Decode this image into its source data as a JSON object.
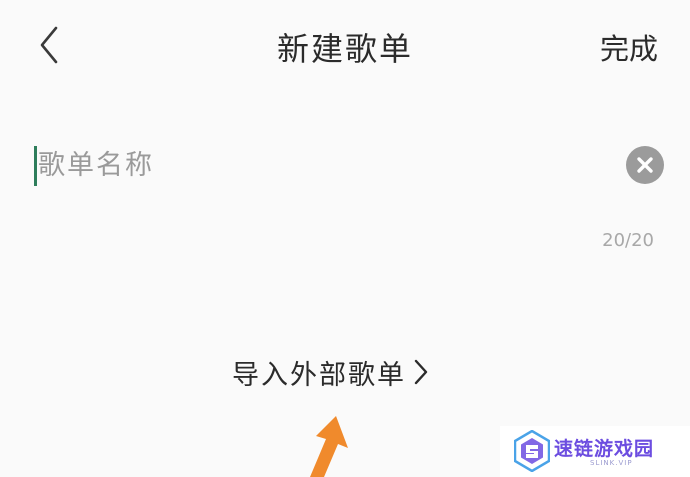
{
  "header": {
    "back_icon": "chevron-left-icon",
    "title": "新建歌单",
    "done_label": "完成"
  },
  "playlist_form": {
    "name_value": "",
    "name_placeholder": "歌单名称",
    "clear_icon": "close-circle-icon",
    "char_counter": "20/20"
  },
  "import": {
    "label": "导入外部歌单",
    "chevron_icon": "chevron-right-icon"
  },
  "annotation": {
    "arrow_icon": "arrow-up-icon",
    "color": "#f08a2c"
  },
  "watermark": {
    "text": "速链游戏园",
    "subtext": "SLINK.VIP",
    "color": "#6c4de0"
  },
  "colors": {
    "caret": "#2e7d5b",
    "clear_button": "#9b9b9b",
    "placeholder": "#9a9a9a"
  }
}
